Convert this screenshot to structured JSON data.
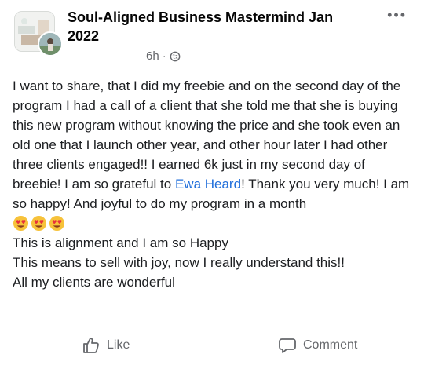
{
  "post": {
    "group_name": "Soul-Aligned Business Mastermind Jan 2022",
    "timestamp": "6h",
    "separator": "·",
    "privacy_icon": "globe-icon",
    "more_icon": "more-horizontal-icon",
    "text_before_mention": "I want to share, that I did my freebie and on the second day of the program I had a call of a client that she told me that she is buying this new program without knowing the price and she took even an old one that I launch other year, and other hour later I had other three clients engaged!! I earned 6k just in my second day of breebie! I am so grateful to ",
    "mention": "Ewa Heard",
    "text_after_mention": "! Thank you very much! I am so happy! And joyful to do my program in a month",
    "emojis": [
      "heart-eyes-emoji",
      "heart-eyes-emoji",
      "heart-eyes-emoji"
    ],
    "line2": "This is alignment and I am so Happy",
    "line3": "This means to sell with joy, now I really understand this!!",
    "line4": "All my clients are wonderful"
  },
  "actions": {
    "like_label": "Like",
    "like_icon": "thumbs-up-icon",
    "comment_label": "Comment",
    "comment_icon": "comment-bubble-icon"
  },
  "colors": {
    "text": "#1c1e21",
    "secondary": "#65676b",
    "link": "#216fdb"
  }
}
